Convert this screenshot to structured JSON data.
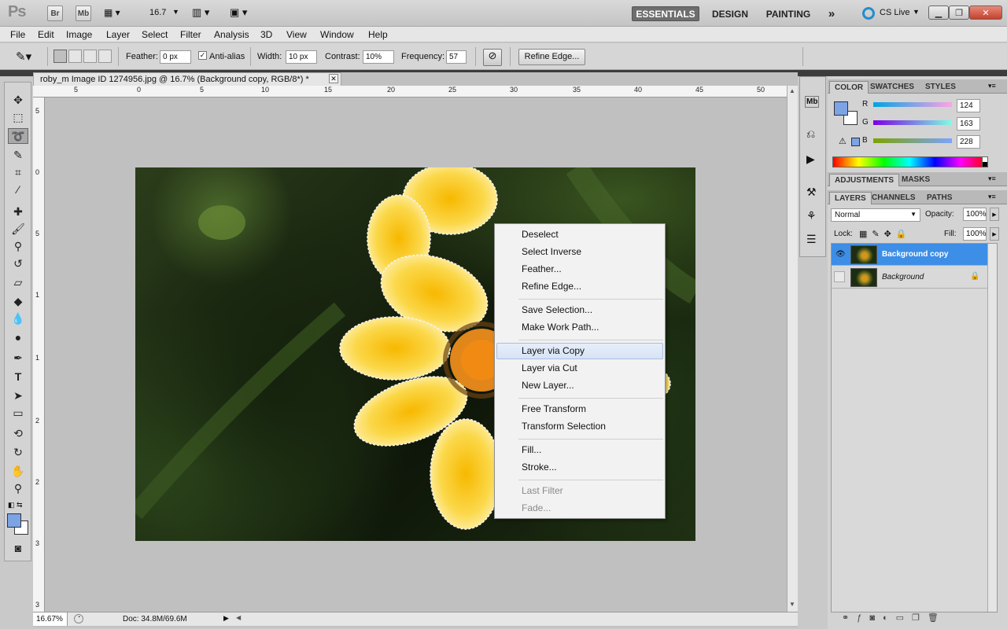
{
  "appbar": {
    "logo": "Ps",
    "bridge_label": "Br",
    "minibridge_label": "Mb",
    "zoom": "16.7",
    "workspaces": [
      "ESSENTIALS",
      "DESIGN",
      "PAINTING"
    ],
    "more": "»",
    "cs_live": "CS Live"
  },
  "menu": [
    "File",
    "Edit",
    "Image",
    "Layer",
    "Select",
    "Filter",
    "Analysis",
    "3D",
    "View",
    "Window",
    "Help"
  ],
  "options": {
    "feather_label": "Feather:",
    "feather_value": "0 px",
    "antialias_label": "Anti-alias",
    "width_label": "Width:",
    "width_value": "10 px",
    "contrast_label": "Contrast:",
    "contrast_value": "10%",
    "frequency_label": "Frequency:",
    "frequency_value": "57",
    "refine_edge": "Refine Edge..."
  },
  "document": {
    "tab_title": "roby_m Image ID  1274956.jpg @ 16.7% (Background copy, RGB/8*) *",
    "ruler_top": [
      "5",
      "0",
      "5",
      "10",
      "15",
      "20",
      "25",
      "30",
      "35",
      "40",
      "45",
      "50"
    ],
    "ruler_left": [
      "5",
      "0",
      "5",
      "1",
      "1",
      "2",
      "2",
      "3",
      "3"
    ],
    "zoom_status": "16.67%",
    "doc_status": "Doc: 34.8M/69.6M"
  },
  "context_menu": {
    "groups": [
      [
        "Deselect",
        "Select Inverse",
        "Feather...",
        "Refine Edge..."
      ],
      [
        "Save Selection...",
        "Make Work Path..."
      ],
      [
        "Layer via Copy",
        "Layer via Cut",
        "New Layer..."
      ],
      [
        "Free Transform",
        "Transform Selection"
      ],
      [
        "Fill...",
        "Stroke..."
      ],
      [
        "Last Filter",
        "Fade..."
      ]
    ],
    "highlighted": "Layer via Copy",
    "disabled": [
      "Last Filter",
      "Fade..."
    ]
  },
  "color_panel": {
    "tabs": [
      "COLOR",
      "SWATCHES",
      "STYLES"
    ],
    "r_label": "R",
    "r_value": "124",
    "g_label": "G",
    "g_value": "163",
    "b_label": "B",
    "b_value": "228",
    "foreground": "#7ca3e4"
  },
  "adjust_tabs": [
    "ADJUSTMENTS",
    "MASKS"
  ],
  "layers_panel": {
    "tabs": [
      "LAYERS",
      "CHANNELS",
      "PATHS"
    ],
    "blend_mode": "Normal",
    "opacity_label": "Opacity:",
    "opacity_value": "100%",
    "lock_label": "Lock:",
    "fill_label": "Fill:",
    "fill_value": "100%",
    "layers": [
      "Background copy",
      "Background"
    ]
  }
}
